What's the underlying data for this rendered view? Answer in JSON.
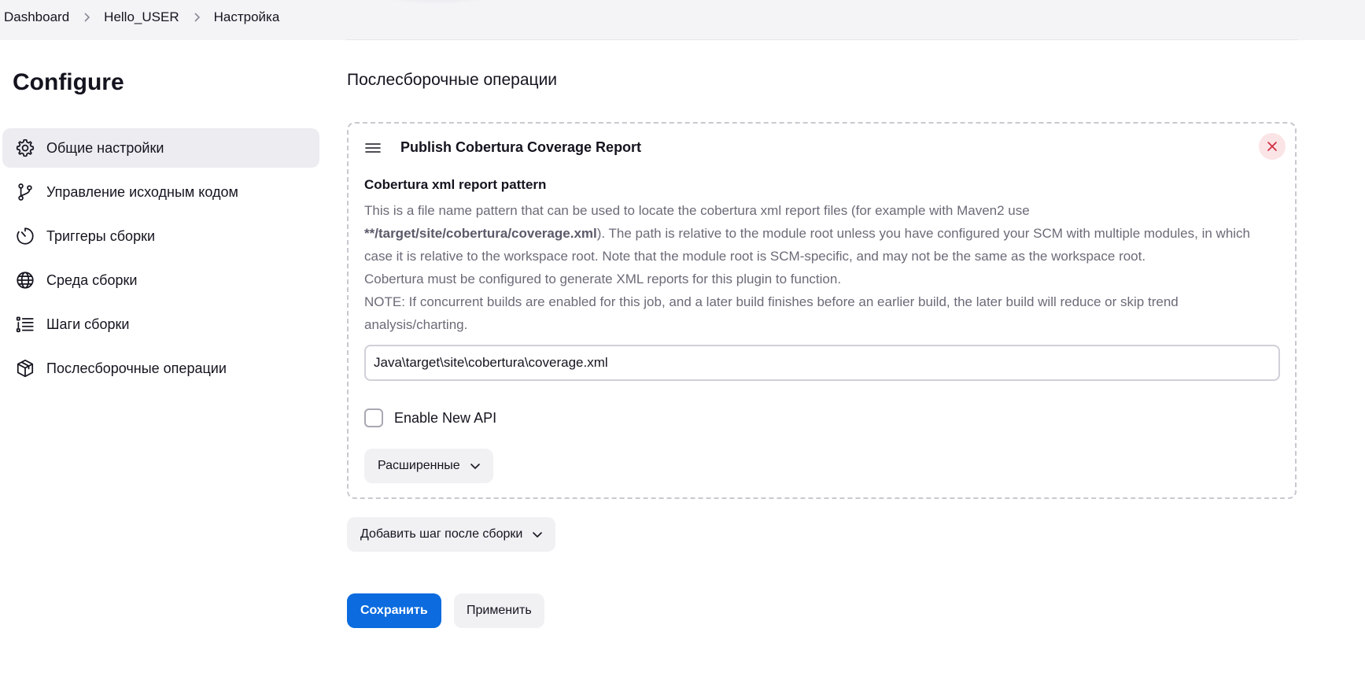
{
  "breadcrumb": [
    "Dashboard",
    "Hello_USER",
    "Настройка"
  ],
  "page_title": "Configure",
  "sidebar": {
    "items": [
      {
        "label": "Общие настройки",
        "icon": "gear-icon",
        "active": true
      },
      {
        "label": "Управление исходным кодом",
        "icon": "source-branch-icon",
        "active": false
      },
      {
        "label": "Триггеры сборки",
        "icon": "timer-icon",
        "active": false
      },
      {
        "label": "Среда сборки",
        "icon": "globe-icon",
        "active": false
      },
      {
        "label": "Шаги сборки",
        "icon": "list-icon",
        "active": false
      },
      {
        "label": "Послесборочные операции",
        "icon": "package-icon",
        "active": false
      }
    ]
  },
  "main": {
    "section_title": "Послесборочные операции",
    "step": {
      "title": "Publish Cobertura Coverage Report",
      "field_label": "Cobertura xml report pattern",
      "help": {
        "line1": "This is a file name pattern that can be used to locate the cobertura xml report files (for example with Maven2 use",
        "bold": "**/target/site/cobertura/coverage.xml",
        "line2": "). The path is relative to the module root unless you have configured your SCM with multiple modules, in which case it is relative to the workspace root. Note that the module root is SCM-specific, and may not be the same as the workspace root.",
        "line3": "Cobertura must be configured to generate XML reports for this plugin to function.",
        "line4": "NOTE: If concurrent builds are enabled for this job, and a later build finishes before an earlier build, the later build will reduce or skip trend analysis/charting."
      },
      "pattern_value": "Java\\target\\site\\cobertura\\coverage.xml",
      "checkbox_label": "Enable New API",
      "checkbox_checked": false,
      "advanced_label": "Расширенные"
    },
    "add_step_label": "Добавить шаг после сборки",
    "save_label": "Сохранить",
    "apply_label": "Применить"
  },
  "colors": {
    "accent": "#0b6bdf",
    "close_bg": "#fbe4e6",
    "close_icon": "#d0283c",
    "active_nav_bg": "#ececf1"
  }
}
